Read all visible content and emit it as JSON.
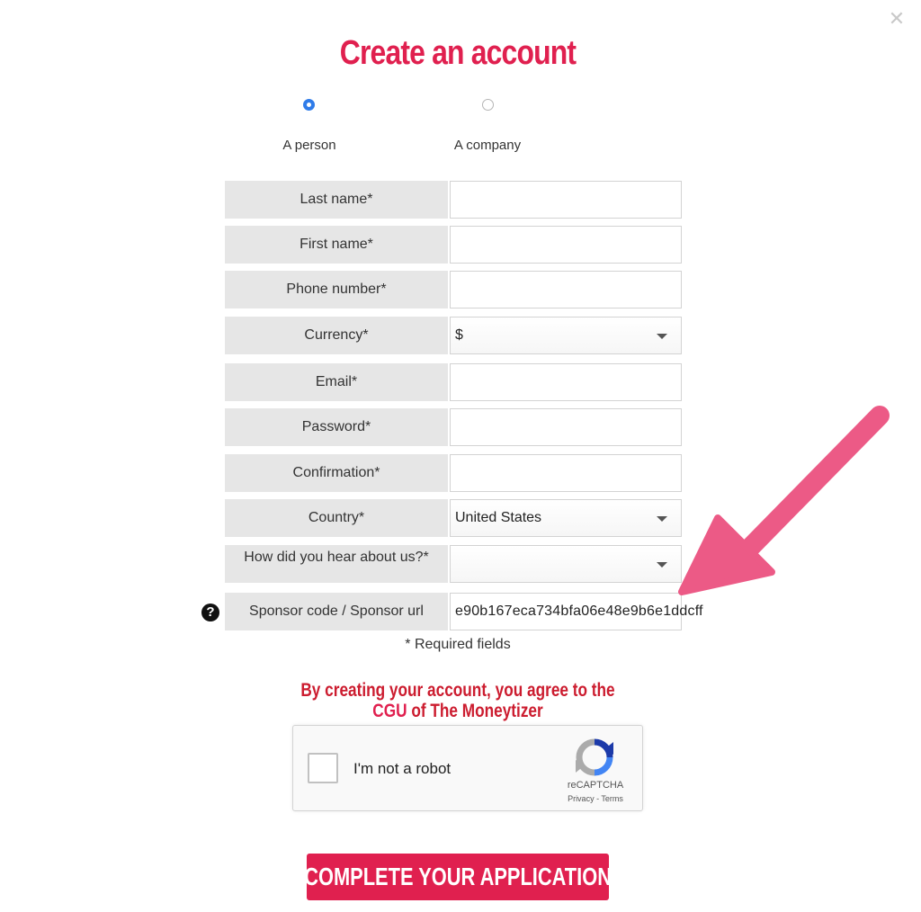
{
  "title": "Create an account",
  "account_type": {
    "options": [
      {
        "label": "A person",
        "selected": true
      },
      {
        "label": "A company",
        "selected": false
      }
    ]
  },
  "form": {
    "last_name": {
      "label": "Last name*",
      "value": ""
    },
    "first_name": {
      "label": "First name*",
      "value": ""
    },
    "phone": {
      "label": "Phone number*",
      "value": ""
    },
    "currency": {
      "label": "Currency*",
      "value": "$"
    },
    "email": {
      "label": "Email*",
      "value": ""
    },
    "password": {
      "label": "Password*",
      "value": ""
    },
    "confirmation": {
      "label": "Confirmation*",
      "value": ""
    },
    "country": {
      "label": "Country*",
      "value": "United States"
    },
    "referral": {
      "label": "How did you hear about us?*",
      "value": ""
    },
    "sponsor": {
      "label": "Sponsor code / Sponsor url",
      "value": "e90b167eca734bfa06e48e9b6e1ddcff"
    }
  },
  "required_note": "* Required fields",
  "agreement": {
    "prefix": "By creating your account, you agree to the ",
    "link": "CGU",
    "suffix": " of The Moneytizer"
  },
  "captcha": {
    "label": "I'm not a robot",
    "brand": "reCAPTCHA",
    "privacy": "Privacy",
    "separator": " - ",
    "terms": "Terms"
  },
  "submit_label": "COMPLETE YOUR APPLICATION",
  "colors": {
    "accent": "#e0204f",
    "arrow": "#ec5a86",
    "radio_selected": "#2f7ce9"
  }
}
